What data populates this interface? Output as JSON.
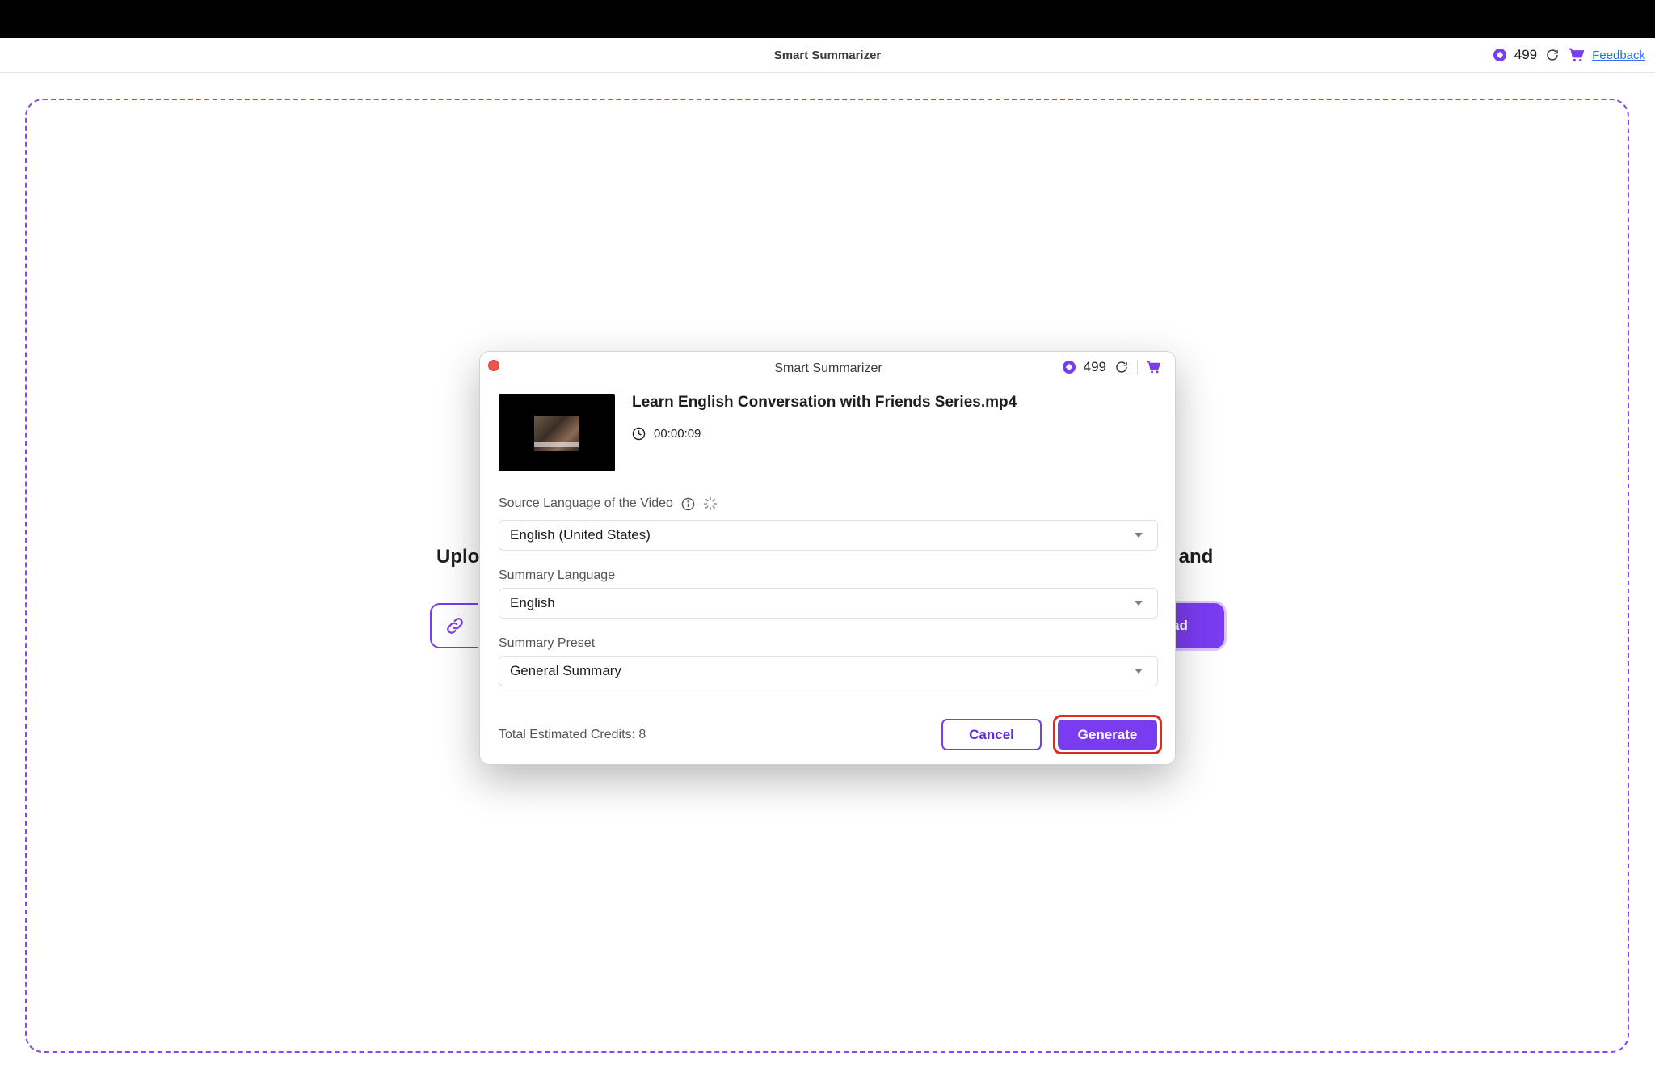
{
  "app": {
    "title": "Smart Summarizer",
    "credits": "499",
    "feedback_label": "Feedback"
  },
  "background": {
    "heading_left": "Uplo",
    "heading_right": "t and",
    "upload_label": "ad"
  },
  "modal": {
    "title": "Smart Summarizer",
    "credits": "499",
    "file": {
      "name": "Learn English Conversation with Friends Series.mp4",
      "duration": "00:00:09"
    },
    "source_language": {
      "label": "Source Language of the Video",
      "value": "English (United States)"
    },
    "summary_language": {
      "label": "Summary Language",
      "value": "English"
    },
    "summary_preset": {
      "label": "Summary Preset",
      "value": "General Summary"
    },
    "total_credits": "Total Estimated Credits: 8",
    "cancel_label": "Cancel",
    "generate_label": "Generate"
  },
  "colors": {
    "accent": "#7a3cf0",
    "highlight_ring": "#e02a1e",
    "link": "#2f6ef0"
  },
  "icons": [
    "coin-icon",
    "refresh-icon",
    "cart-icon",
    "link-icon",
    "clock-icon",
    "info-icon",
    "spinner-icon",
    "chevron-down-icon"
  ]
}
